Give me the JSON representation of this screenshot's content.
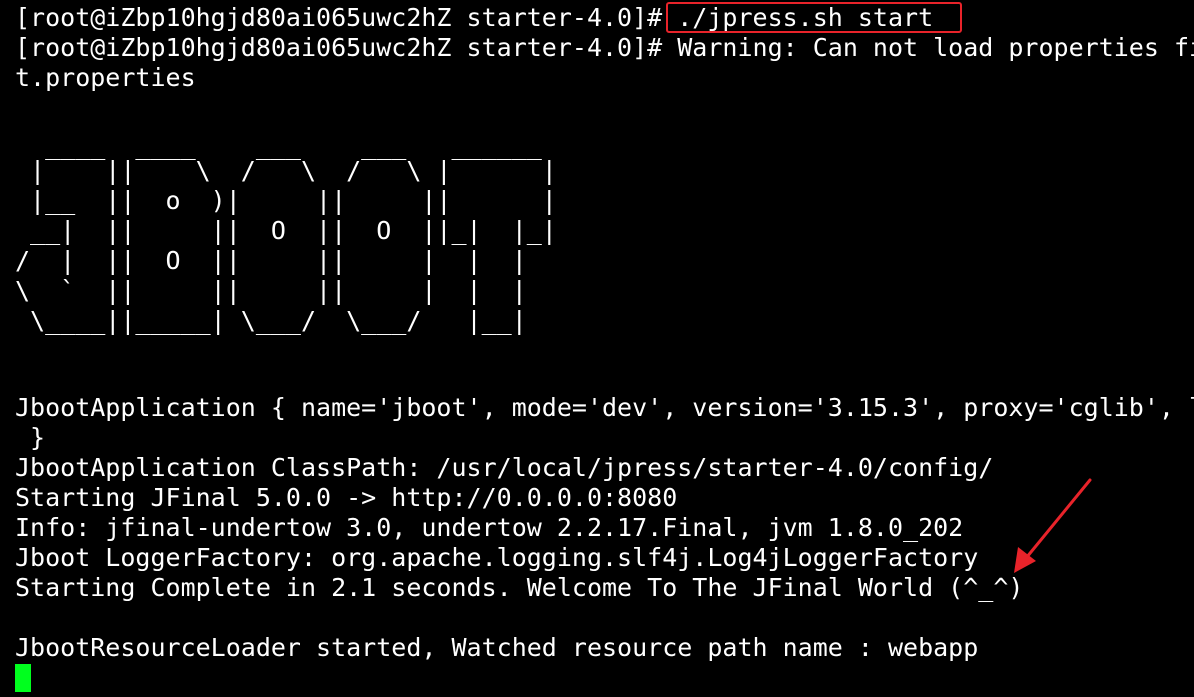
{
  "terminal": {
    "lines": {
      "partial_top": "                                      ~",
      "l1": "[root@iZbp10hgjd80ai065uwc2hZ starter-4.0]# ./jpress.sh start",
      "l2": "[root@iZbp10hgjd80ai065uwc2hZ starter-4.0]# Warning: Can not load properties fi",
      "l3": "t.properties",
      "a1": "  ____  ____    ___    ___   ______",
      "a2": " |    ||    \\  /   \\  /   \\ |      |",
      "a3": " |__  ||  o  )|     ||     ||      |",
      "a4": " __|  ||     ||  O  ||  O  ||_|  |_|",
      "a5": "/  |  ||  O  ||     ||     |  |  |",
      "a6": "\\  `  ||     ||     ||     |  |  |",
      "a7": " \\____||_____| \\___/  \\___/   |__|",
      "l11": "JbootApplication { name='jboot', mode='dev', version='3.15.3', proxy='cglib', l",
      "l12": " }",
      "l13": "JbootApplication ClassPath: /usr/local/jpress/starter-4.0/config/",
      "l14": "Starting JFinal 5.0.0 -> http://0.0.0.0:8080",
      "l15": "Info: jfinal-undertow 3.0, undertow 2.2.17.Final, jvm 1.8.0_202",
      "l16": "Jboot LoggerFactory: org.apache.logging.slf4j.Log4jLoggerFactory",
      "l17": "Starting Complete in 2.1 seconds. Welcome To The JFinal World (^_^)",
      "l18": "JbootResourceLoader started, Watched resource path name : webapp"
    },
    "colors": {
      "background": "#000000",
      "text": "#ffffff",
      "cursor": "#00ff1e",
      "annotation": "#e8232a"
    }
  },
  "annotations": {
    "highlight_target": "./jpress.sh start",
    "arrow_icon": "red-arrow-icon"
  }
}
